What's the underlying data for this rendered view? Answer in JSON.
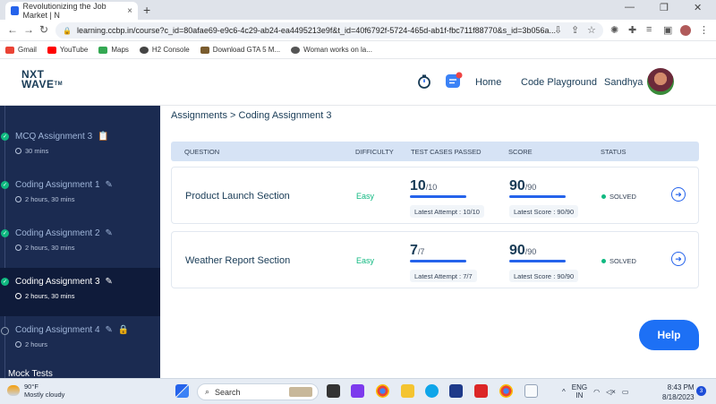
{
  "browser": {
    "tab_title": "Revolutionizing the Job Market | N",
    "tab_close": "×",
    "new_tab": "+",
    "url": "learning.ccbp.in/course?c_id=80afae69-e9c6-4c29-ab24-ea4495213e9f&t_id=40f6792f-5724-465d-ab1f-fbc711f88770&s_id=3b056a...",
    "bookmarks": [
      {
        "label": "Gmail",
        "color": "#ea4335"
      },
      {
        "label": "YouTube",
        "color": "#ff0000"
      },
      {
        "label": "Maps",
        "color": "#34a853"
      },
      {
        "label": "H2 Console",
        "color": "#444444"
      },
      {
        "label": "Download GTA 5 M...",
        "color": "#7a5c2e"
      },
      {
        "label": "Woman works on la...",
        "color": "#555555"
      }
    ]
  },
  "header": {
    "logo_line1": "NXT",
    "logo_line2": "WAVE",
    "logo_tm": "TM",
    "nav_home": "Home",
    "nav_playground": "Code Playground",
    "user_name": "Sandhya"
  },
  "sidebar": {
    "items": [
      {
        "title": "MCQ Assignment 3",
        "time": "30 mins",
        "status": "done"
      },
      {
        "title": "Coding Assignment 1",
        "time": "2 hours, 30 mins",
        "status": "done"
      },
      {
        "title": "Coding Assignment 2",
        "time": "2 hours, 30 mins",
        "status": "done"
      },
      {
        "title": "Coding Assignment 3",
        "time": "2 hours, 30 mins",
        "status": "done"
      },
      {
        "title": "Coding Assignment 4",
        "time": "2 hours",
        "status": "locked"
      }
    ],
    "footer": "Mock Tests"
  },
  "main": {
    "breadcrumb": "Assignments > Coding Assignment 3",
    "columns": {
      "question": "QUESTION",
      "difficulty": "DIFFICULTY",
      "tests": "TEST CASES PASSED",
      "score": "SCORE",
      "status": "STATUS"
    },
    "rows": [
      {
        "question": "Product Launch Section",
        "difficulty": "Easy",
        "tests_passed": "10",
        "tests_total": "/10",
        "latest_attempt": "Latest Attempt : 10/10",
        "score": "90",
        "score_total": "/90",
        "latest_score": "Latest Score : 90/90",
        "status": "SOLVED"
      },
      {
        "question": "Weather Report Section",
        "difficulty": "Easy",
        "tests_passed": "7",
        "tests_total": "/7",
        "latest_attempt": "Latest Attempt : 7/7",
        "score": "90",
        "score_total": "/90",
        "latest_score": "Latest Score : 90/90",
        "status": "SOLVED"
      }
    ],
    "help_label": "Help"
  },
  "taskbar": {
    "weather_temp": "90°F",
    "weather_desc": "Mostly cloudy",
    "search_label": "Search",
    "lang1": "ENG",
    "lang2": "IN",
    "time": "8:43 PM",
    "date": "8/18/2023",
    "notif_count": "3"
  },
  "colors": {
    "sidebar_bg": "#1b2b51",
    "accent": "#2563eb",
    "success": "#10b981",
    "help": "#1d70f5"
  }
}
